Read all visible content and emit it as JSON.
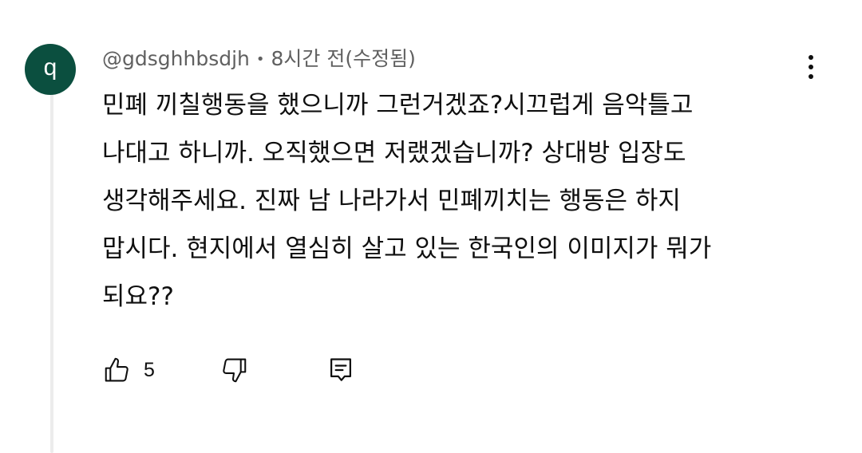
{
  "comment": {
    "avatar_letter": "q",
    "avatar_color": "#0b4f3f",
    "author": "@gdsghhbsdjh",
    "separator": "•",
    "time": "8시간 전(수정됨)",
    "text_lines": [
      "민폐 끼칠행동을 했으니까 그런거겠죠?시끄럽게 음악틀고",
      "나대고 하니까. 오직했으면 저랬겠습니까? 상대방 입장도",
      "생각해주세요. 진짜 남 나라가서 민폐끼치는 행동은 하지",
      "맙시다. 현지에서 열심히 살고 있는 한국인의 이미지가 뭐가",
      "되요??"
    ],
    "like_count": "5"
  },
  "icons": {
    "like": "thumbs-up-icon",
    "dislike": "thumbs-down-icon",
    "reply": "reply-comment-icon",
    "more": "more-vertical-icon"
  }
}
